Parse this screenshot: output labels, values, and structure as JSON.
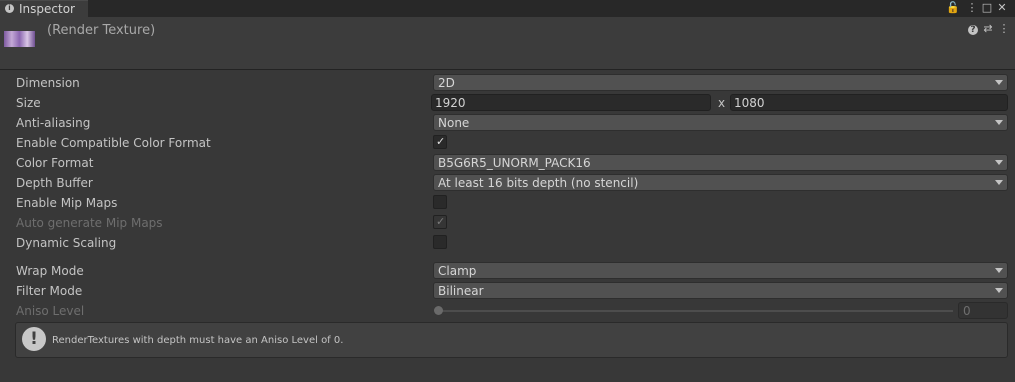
{
  "tab": {
    "label": "Inspector",
    "icon": "info-icon"
  },
  "window_buttons": {
    "lock": "🔓",
    "menu": "⋮",
    "maximize": "□",
    "close": "✕"
  },
  "header": {
    "title": "(Render Texture)",
    "help": "?",
    "presets": "⇄",
    "more": "⋮"
  },
  "properties": {
    "dimension": {
      "label": "Dimension",
      "value": "2D"
    },
    "size": {
      "label": "Size",
      "width": "1920",
      "separator": "x",
      "height": "1080"
    },
    "anti_aliasing": {
      "label": "Anti-aliasing",
      "value": "None"
    },
    "compat_color": {
      "label": "Enable Compatible Color Format",
      "checked": true
    },
    "color_format": {
      "label": "Color Format",
      "value": "B5G6R5_UNORM_PACK16"
    },
    "depth_buffer": {
      "label": "Depth Buffer",
      "value": "At least 16 bits depth (no stencil)"
    },
    "mip_maps": {
      "label": "Enable Mip Maps",
      "checked": false
    },
    "auto_mip": {
      "label": "Auto generate Mip Maps",
      "checked": true
    },
    "dynamic_scaling": {
      "label": "Dynamic Scaling",
      "checked": false
    },
    "wrap_mode": {
      "label": "Wrap Mode",
      "value": "Clamp"
    },
    "filter_mode": {
      "label": "Filter Mode",
      "value": "Bilinear"
    },
    "aniso_level": {
      "label": "Aniso Level",
      "value": "0",
      "fraction": 0.0
    }
  },
  "marks": {
    "check": "✓"
  },
  "helpbox": {
    "icon": "!",
    "message": "RenderTextures with depth must have an Aniso Level of 0."
  }
}
